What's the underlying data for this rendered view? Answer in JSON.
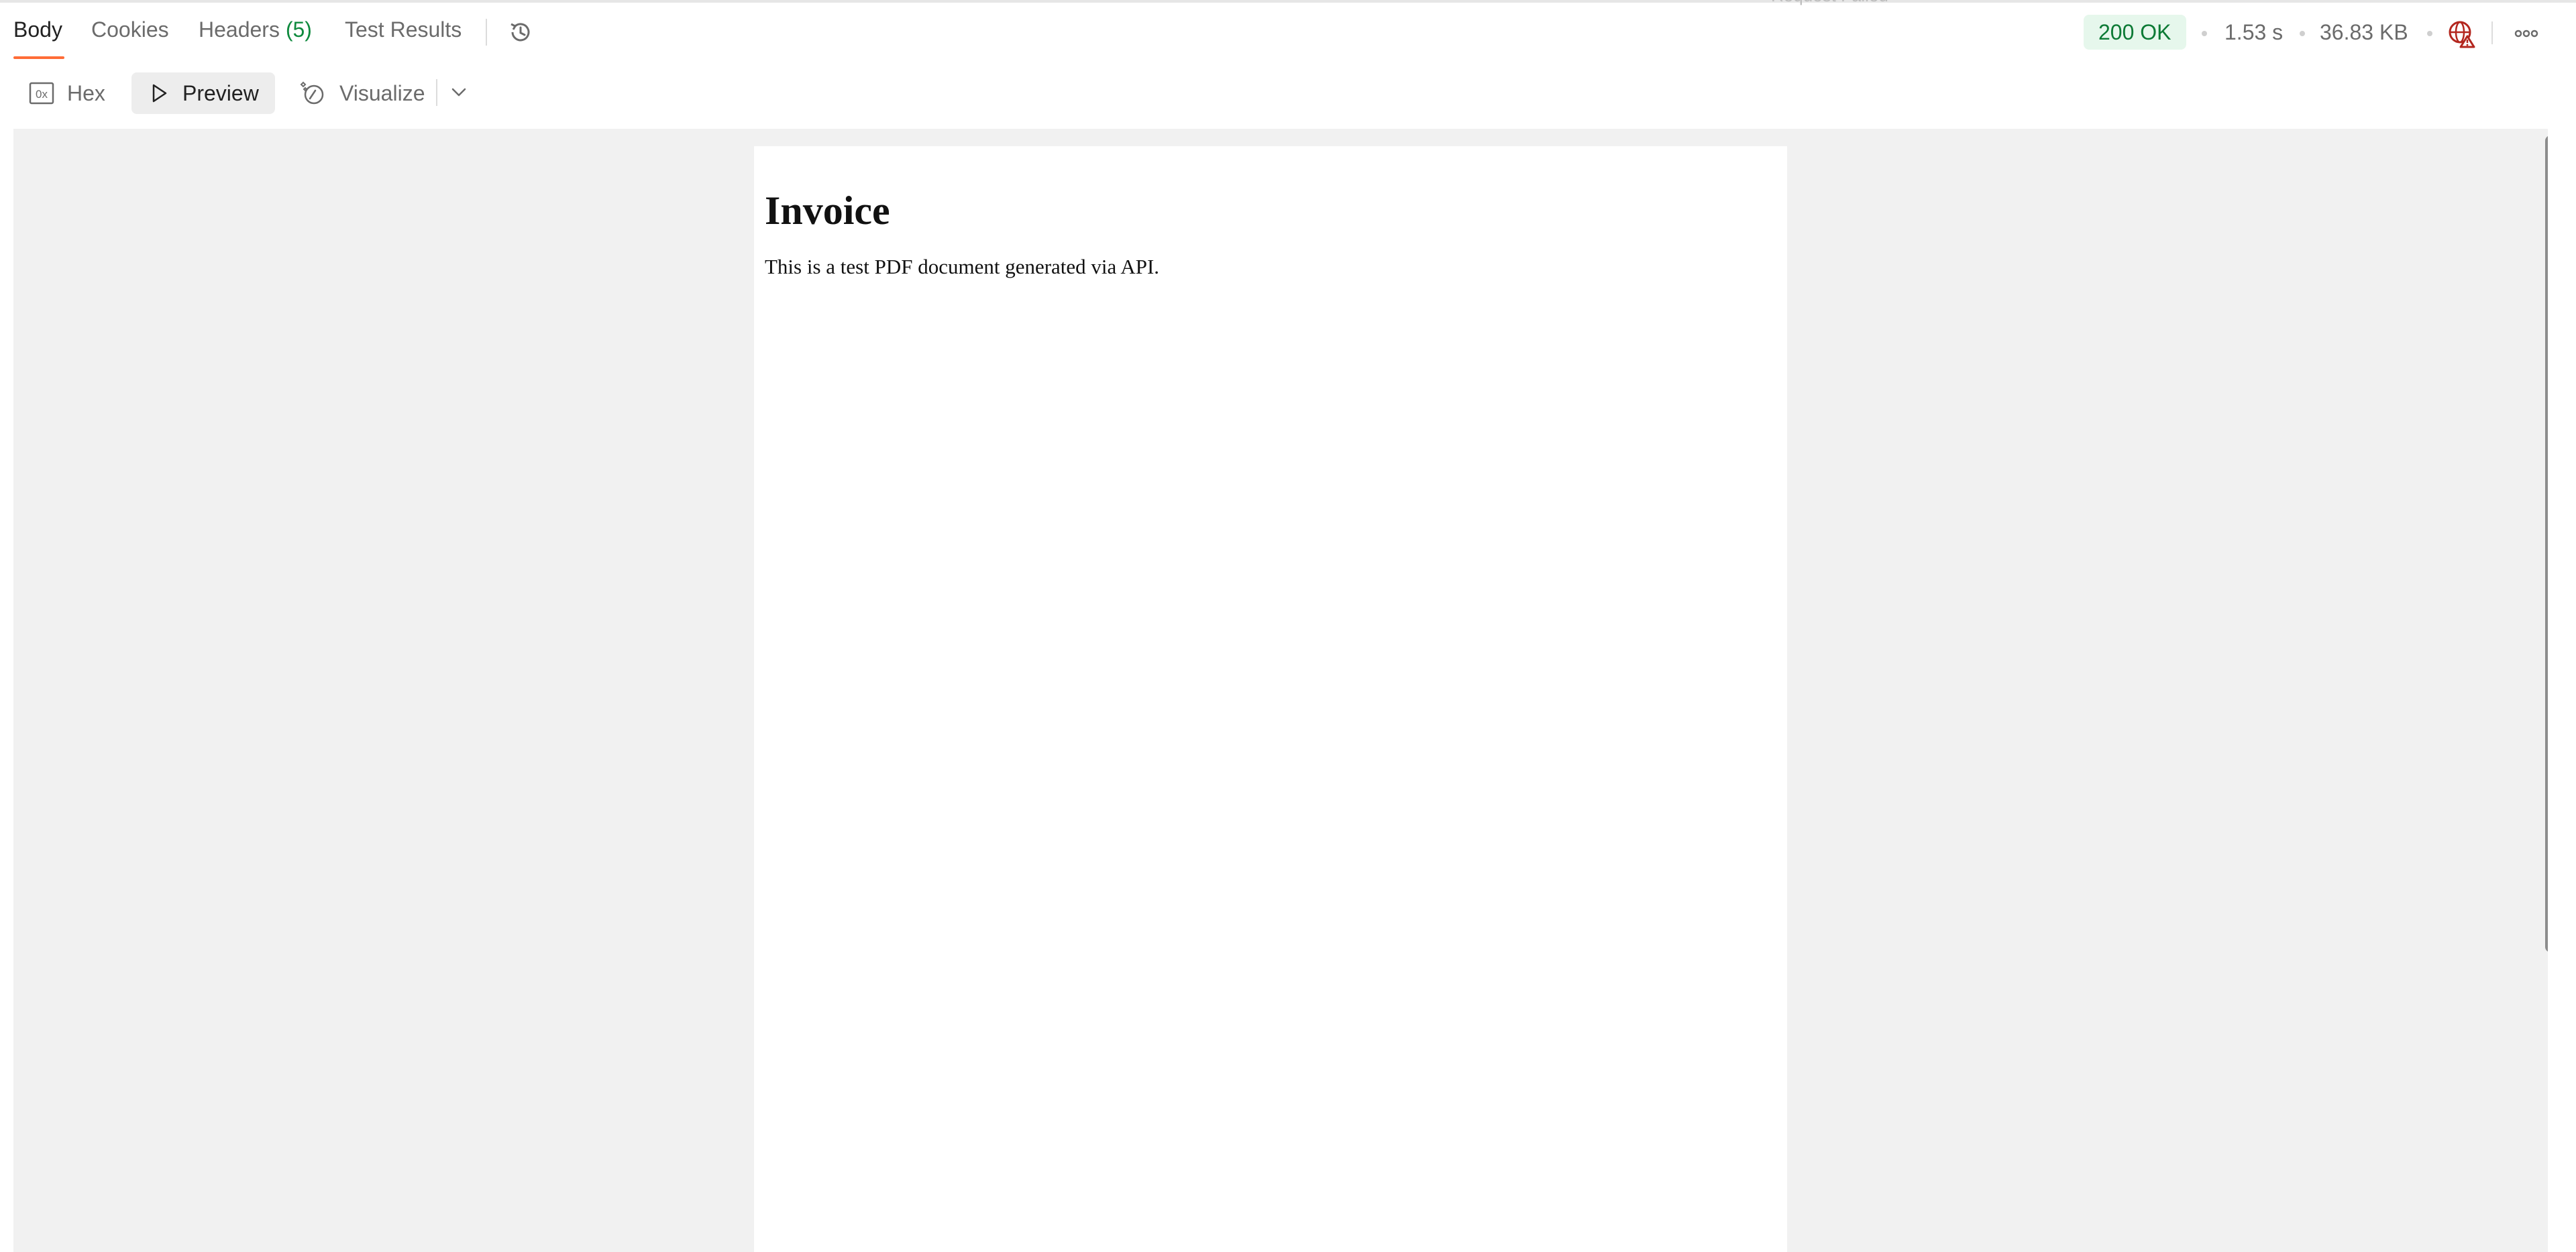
{
  "header_faint_text": "Request Failed",
  "tabs": [
    {
      "label": "Body"
    },
    {
      "label": "Cookies"
    },
    {
      "label": "Headers",
      "count": "(5)"
    },
    {
      "label": "Test Results"
    }
  ],
  "status": {
    "code": "200 OK",
    "time": "1.53 s",
    "size": "36.83 KB"
  },
  "view_modes": {
    "hex": "Hex",
    "preview": "Preview",
    "visualize": "Visualize"
  },
  "colors": {
    "accent": "#ff6c37",
    "status_bg": "#e6f7ec",
    "status_text": "#0c7a35",
    "warning": "#b3261e"
  },
  "icons": [
    "history-icon",
    "hex-icon",
    "play-icon",
    "visualize-icon",
    "chevron-down-icon",
    "network-warning-icon",
    "more-options-icon"
  ],
  "document": {
    "title": "Invoice",
    "body": "This is a test PDF document generated via API."
  }
}
